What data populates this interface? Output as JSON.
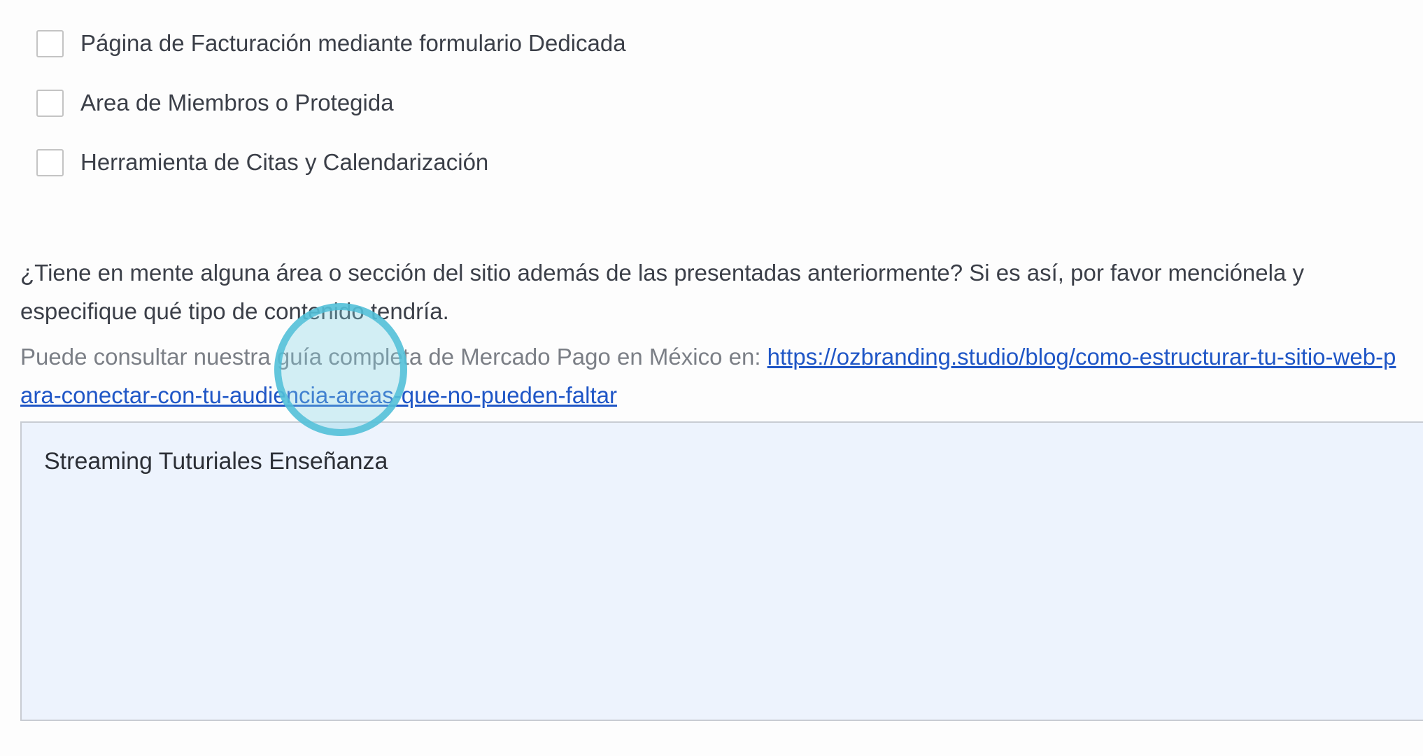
{
  "checkboxes": [
    {
      "label": "Página de Facturación mediante formulario Dedicada",
      "checked": false
    },
    {
      "label": "Area de Miembros o Protegida",
      "checked": false
    },
    {
      "label": "Herramienta de Citas y Calendarización",
      "checked": false
    }
  ],
  "question": {
    "text": "¿Tiene en mente alguna área o sección del sitio además de las presentadas anteriormente? Si es así, por favor menciónela y especifique qué tipo de contenido tendría."
  },
  "hint": {
    "prefix": "Puede consultar nuestra guía completa de Mercado Pago en México en: ",
    "link": "https://ozbranding.studio/blog/como-estructurar-tu-sitio-web-para-conectar-con-tu-audiencia-areas-que-no-pueden-faltar"
  },
  "answer": {
    "value": "Streaming Tuturiales Enseñanza"
  },
  "colors": {
    "text": "#3b3f48",
    "hint": "#7b7f86",
    "link": "#1f56c6",
    "textarea_bg": "#edf3fd",
    "cursor_ring": "#50bed7"
  }
}
